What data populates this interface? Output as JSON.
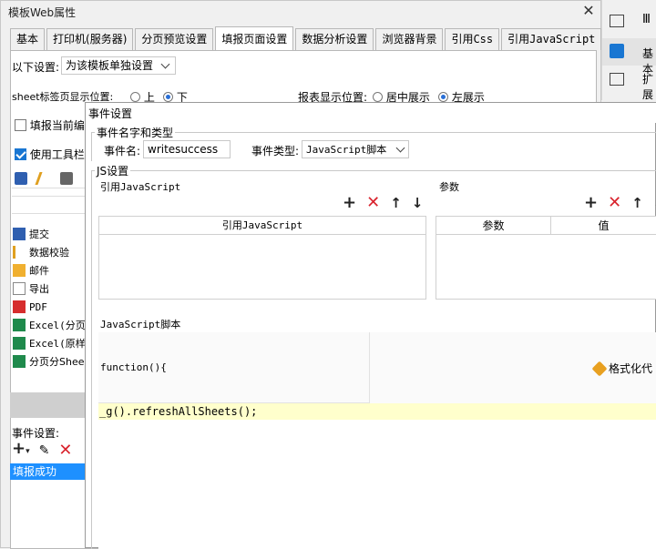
{
  "back_window": {
    "title": "模板Web属性",
    "tabs": [
      "基本",
      "打印机(服务器)",
      "分页预览设置",
      "填报页面设置",
      "数据分析设置",
      "浏览器背景",
      "引用Css",
      "引用JavaScript"
    ],
    "active_tab": 3,
    "setting_label": "以下设置:",
    "setting_value": "为该模板单独设置",
    "sheet_tab_pos_label": "sheet标签页显示位置:",
    "sheet_tab_opt_top": "上",
    "sheet_tab_opt_bottom": "下",
    "report_pos_label": "报表显示位置:",
    "report_opt_center": "居中展示",
    "report_opt_left": "左展示",
    "fill_current_label": "填报当前编",
    "use_toolbar_label": "使用工具栏",
    "list_items": [
      "提交",
      "数据校验",
      "邮件",
      "导出",
      "PDF",
      "Excel(分页",
      "Excel(原样",
      "分页分Shee"
    ],
    "event_settings_label": "事件设置:",
    "event_item": "填报成功"
  },
  "right_sidebar": {
    "label_basic": "基本",
    "label_extend": "扩展",
    "label_top_cut": "Ⅲ"
  },
  "dialog": {
    "title": "事件设置",
    "group_name_type": "事件名字和类型",
    "event_name_label": "事件名:",
    "event_name_value": "writesuccess",
    "event_type_label": "事件类型:",
    "event_type_value": "JavaScript脚本",
    "group_js": "JS设置",
    "ref_js_label": "引用JavaScript",
    "params_label": "参数",
    "ref_js_column": "引用JavaScript",
    "param_col_name": "参数",
    "param_col_value": "值",
    "js_script_label": "JavaScript脚本",
    "function_signature": "function(){",
    "format_button": "格式化代",
    "code_line": "_g().refreshAllSheets();"
  },
  "colors": {
    "accent": "#1976d2",
    "delete_red": "#d9232d",
    "code_highlight": "#ffffcc",
    "selection": "#1e90ff"
  }
}
